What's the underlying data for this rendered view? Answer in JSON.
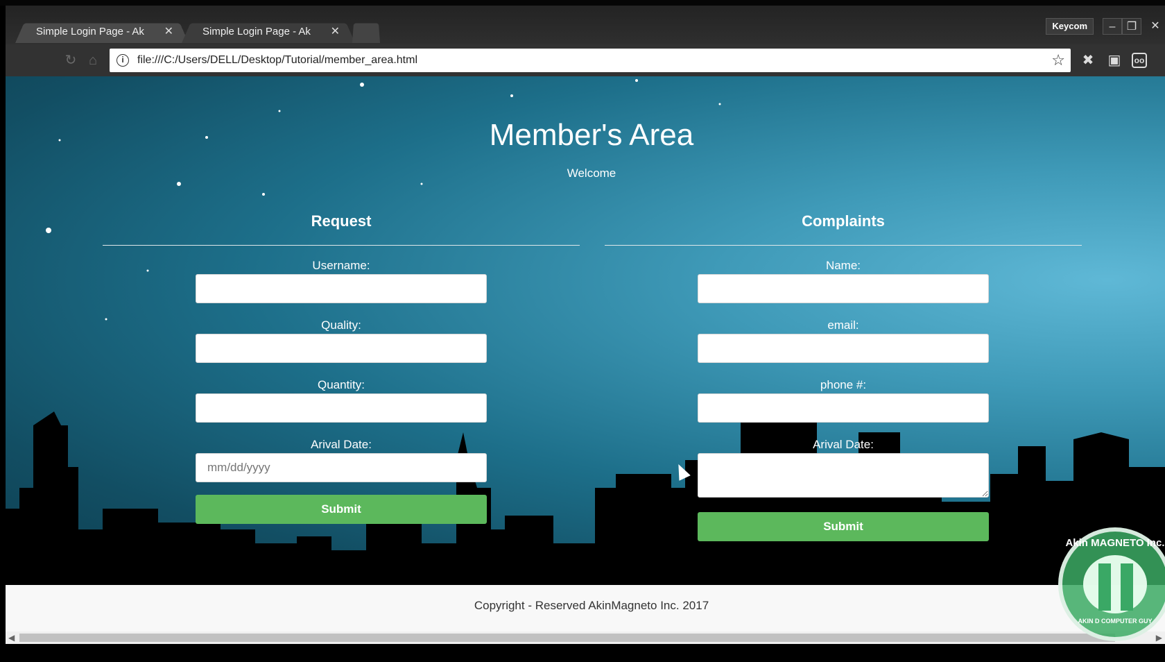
{
  "browser": {
    "tabs": [
      {
        "title": "Simple Login Page - Ak",
        "close": "✕"
      },
      {
        "title": "Simple Login Page - Ak",
        "close": "✕"
      }
    ],
    "window_label": "Keycom",
    "minimize": "–",
    "maximize": "❐",
    "close": "✕",
    "url": "file:///C:/Users/DELL/Desktop/Tutorial/member_area.html",
    "icons": [
      "reload-icon",
      "home-icon",
      "info-icon",
      "star-icon",
      "extension-icon",
      "camera-icon",
      "toolbar-icon"
    ]
  },
  "page": {
    "title": "Member's Area",
    "subtitle": "Welcome"
  },
  "request_form": {
    "heading": "Request",
    "fields": [
      {
        "label": "Username:",
        "value": "",
        "placeholder": ""
      },
      {
        "label": "Quality:",
        "value": "",
        "placeholder": ""
      },
      {
        "label": "Quantity:",
        "value": "",
        "placeholder": ""
      },
      {
        "label": "Arival Date:",
        "value": "",
        "placeholder": "mm/dd/yyyy"
      }
    ],
    "submit": "Submit"
  },
  "complaints_form": {
    "heading": "Complaints",
    "fields": [
      {
        "label": "Name:",
        "value": ""
      },
      {
        "label": "email:",
        "value": ""
      },
      {
        "label": "phone #:",
        "value": ""
      },
      {
        "label": "Arival Date:",
        "value": ""
      }
    ],
    "submit": "Submit"
  },
  "footer": {
    "text": "Copyright - Reserved AkinMagneto Inc. 2017"
  },
  "watermark": {
    "top_text": "Akin MAGNETO Inc.",
    "bottom_text": "AKIN D COMPUTER GUY"
  },
  "colors": {
    "submit_green": "#5cb85c",
    "sky_dark": "#0d3d4f",
    "sky_light": "#5fb8d6"
  }
}
